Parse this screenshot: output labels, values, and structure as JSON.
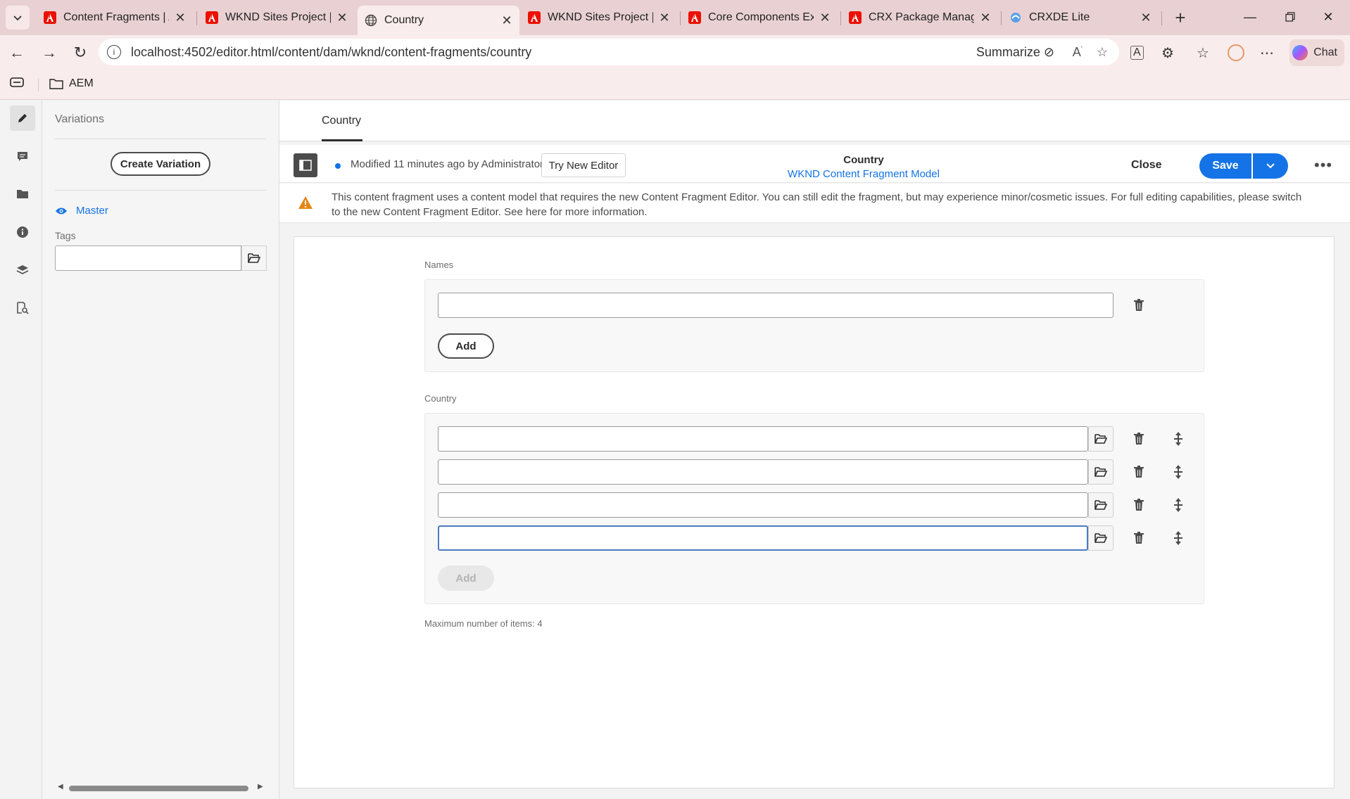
{
  "browser": {
    "tabs": [
      {
        "title": "Content Fragments | AE",
        "icon": "adobe-icon"
      },
      {
        "title": "WKND Sites Project | Co",
        "icon": "adobe-icon"
      },
      {
        "title": "Country",
        "icon": "globe-icon"
      },
      {
        "title": "WKND Sites Project | Co",
        "icon": "adobe-icon"
      },
      {
        "title": "Core Components Exam",
        "icon": "adobe-icon"
      },
      {
        "title": "CRX Package Manager",
        "icon": "adobe-icon"
      },
      {
        "title": "CRXDE Lite",
        "icon": "crxde-icon"
      }
    ],
    "url": "localhost:4502/editor.html/content/dam/wknd/content-fragments/country",
    "summarize_label": "Summarize",
    "chat_label": "Chat",
    "bookmark": "AEM"
  },
  "sidebar": {
    "header": "Variations",
    "create_variation_label": "Create Variation",
    "master_label": "Master",
    "tags_label": "Tags",
    "tags_value": ""
  },
  "main": {
    "tab_label": "Country",
    "modified_text": "Modified 11 minutes ago by Administrator",
    "try_new_editor_label": "Try New Editor",
    "fragment_title": "Country",
    "fragment_model": "WKND Content Fragment Model",
    "close_label": "Close",
    "save_label": "Save",
    "warning_text": "This content fragment uses a content model that requires the new Content Fragment Editor. You can still edit the fragment, but may experience minor/cosmetic issues. For full editing capabilities, please switch to the new Content Fragment Editor. See here for more information.",
    "names": {
      "label": "Names",
      "values": [
        ""
      ],
      "add_label": "Add"
    },
    "country": {
      "label": "Country",
      "values": [
        "",
        "",
        "",
        ""
      ],
      "add_label": "Add",
      "max_text": "Maximum number of items: 4"
    }
  },
  "colors": {
    "accent": "#1473e6",
    "tabbar": "#e9d1d3",
    "warning": "#e68619"
  }
}
